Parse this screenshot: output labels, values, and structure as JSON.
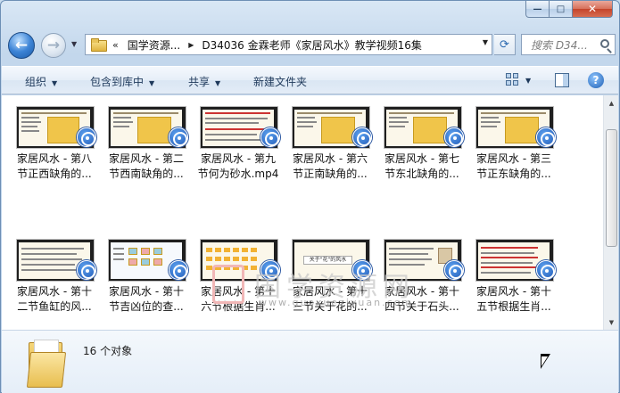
{
  "window": {
    "caption": {
      "minimize": "—",
      "maximize": "□",
      "close": "✕"
    }
  },
  "nav": {
    "back_icon": "back-arrow-icon",
    "forward_icon": "forward-arrow-icon",
    "breadcrumb_chevron": "«",
    "breadcrumbs": [
      "国学资源...",
      "D34036 金霖老师《家居风水》教学视频16集"
    ],
    "search_placeholder": "搜索 D34..."
  },
  "toolbar": {
    "organize": "组织",
    "include_in_library": "包含到库中",
    "share": "共享",
    "new_folder": "新建文件夹"
  },
  "files": [
    {
      "line1": "家居风水 - 第八",
      "line2": "节正西缺角的..."
    },
    {
      "line1": "家居风水 - 第二",
      "line2": "节西南缺角的..."
    },
    {
      "line1": "家居风水 - 第九",
      "line2": "节何为砂水.mp4"
    },
    {
      "line1": "家居风水 - 第六",
      "line2": "节正南缺角的..."
    },
    {
      "line1": "家居风水 - 第七",
      "line2": "节东北缺角的..."
    },
    {
      "line1": "家居风水 - 第三",
      "line2": "节正东缺角的..."
    },
    {
      "line1": "家居风水 - 第十",
      "line2": "二节鱼缸的风..."
    },
    {
      "line1": "家居风水 - 第十",
      "line2": "节吉凶位的查..."
    },
    {
      "line1": "家居风水 - 第十",
      "line2": "六节根据生肖..."
    },
    {
      "line1": "家居风水 - 第十",
      "line2": "三节关于花的..."
    },
    {
      "line1": "家居风水 - 第十",
      "line2": "四节关于石头..."
    },
    {
      "line1": "家居风水 - 第十",
      "line2": "五节根据生肖..."
    }
  ],
  "thumb_texts": {
    "flower_slide": "关于\"花\"的风水"
  },
  "watermark": {
    "text": "国学资源网",
    "url": "www.guoxueziyuan.com"
  },
  "details": {
    "count": "16 个对象"
  }
}
